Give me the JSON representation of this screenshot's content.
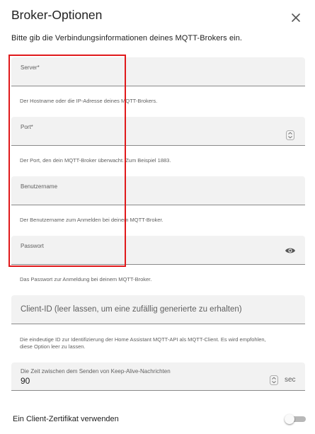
{
  "dialog": {
    "title": "Broker-Optionen",
    "intro": "Bitte gib die Verbindungsinformationen deines MQTT-Brokers ein."
  },
  "fields": {
    "server": {
      "label": "Server*",
      "value": "",
      "helper": "Der Hostname oder die IP-Adresse deines MQTT-Brokers."
    },
    "port": {
      "label": "Port*",
      "value": "",
      "helper": "Der Port, den dein MQTT-Broker überwacht. Zum Beispiel 1883."
    },
    "username": {
      "label": "Benutzername",
      "value": "",
      "helper": "Der Benutzername zum Anmelden bei deinem MQTT-Broker."
    },
    "password": {
      "label": "Passwort",
      "value": "",
      "helper": "Das Passwort zur Anmeldung bei deinem MQTT-Broker."
    },
    "client_id": {
      "placeholder": "Client-ID (leer lassen, um eine zufällig generierte zu erhalten)",
      "helper_line1": "Die eindeutige ID zur Identifizierung der Home Assistant MQTT-API als MQTT-Client. Es wird empfohlen,",
      "helper_line2": "diese Option leer zu lassen."
    },
    "keepalive": {
      "label": "Die Zeit zwischen dem Senden von Keep-Alive-Nachrichten",
      "value": "90",
      "unit": "sec"
    }
  },
  "client_cert": {
    "label": "Ein Client-Zertifikat verwenden",
    "enabled": false
  },
  "icons": {
    "close": "close-icon",
    "stepper": "stepper-icon",
    "visibility": "eye-icon"
  },
  "colors": {
    "field_bg": "#f2f2f2",
    "highlight_box": "#e0191b",
    "toggle_track": "#b8b8b8"
  }
}
